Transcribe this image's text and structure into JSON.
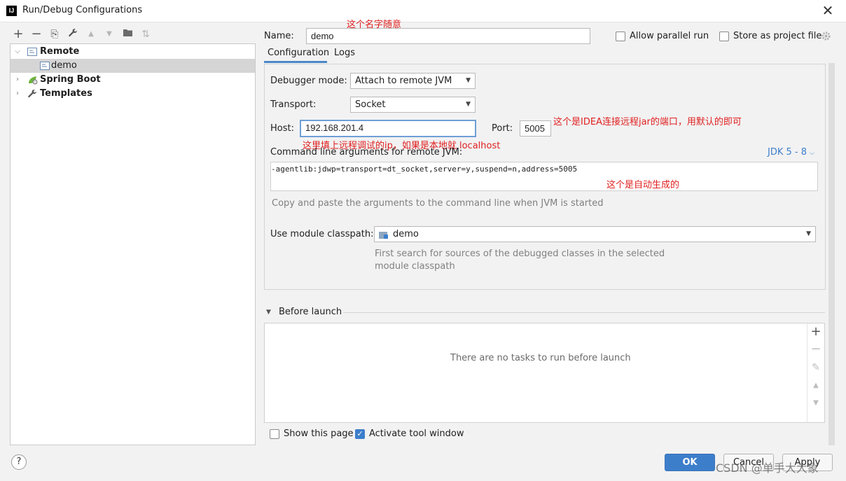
{
  "window": {
    "title": "Run/Debug Configurations",
    "app_icon_text": "IJ",
    "close_glyph": "✕"
  },
  "toolbar": {
    "icons": [
      {
        "name": "add-icon",
        "glyph": "+"
      },
      {
        "name": "remove-icon",
        "glyph": "−"
      },
      {
        "name": "copy-icon",
        "glyph": "⎘"
      },
      {
        "name": "wrench-icon",
        "glyph": "🔧"
      },
      {
        "name": "move-up-icon",
        "glyph": "▲"
      },
      {
        "name": "move-down-icon",
        "glyph": "▼"
      },
      {
        "name": "folder-icon",
        "glyph": "▆"
      },
      {
        "name": "sort-icon",
        "glyph": "⇅"
      }
    ]
  },
  "tree": {
    "remote": "Remote",
    "demo": "demo",
    "spring_boot": "Spring Boot",
    "templates": "Templates"
  },
  "form": {
    "name_label": "Name:",
    "name_value": "demo",
    "allow_parallel": "Allow parallel run",
    "store_project": "Store as project file",
    "tabs": [
      "Configuration",
      "Logs"
    ],
    "debugger_mode_label": "Debugger mode:",
    "debugger_mode_value": "Attach to remote JVM",
    "transport_label": "Transport:",
    "transport_value": "Socket",
    "host_label": "Host:",
    "host_value": "192.168.201.4",
    "port_label": "Port:",
    "port_value": "5005",
    "cmd_label": "Command line arguments for remote JVM:",
    "jdk_label": "JDK 5 - 8",
    "cmd_value": "-agentlib:jdwp=transport=dt_socket,server=y,suspend=n,address=5005",
    "cmd_hint": "Copy and paste the arguments to the command line when JVM is started",
    "module_label": "Use module classpath:",
    "module_value": "demo",
    "module_hint_1": "First search for sources of the debugged classes in the selected",
    "module_hint_2": "module classpath"
  },
  "before_launch": {
    "title": "Before launch",
    "empty": "There are no tasks to run before launch",
    "show_page": "Show this page",
    "activate_tool": "Activate tool window"
  },
  "buttons": {
    "help": "?",
    "ok": "OK",
    "cancel": "Cancel",
    "apply": "Apply"
  },
  "annotations": {
    "name_note": "这个名字随意",
    "port_note": "这个是IDEA连接远程jar的端口，用默认的即可",
    "host_note": "这里填上远程调试的ip，如果是本地就 localhost",
    "cmd_note": "这个是自动生成的"
  },
  "watermark": "CSDN @单手大大象",
  "colors": {
    "accent": "#3d7ecb",
    "annotation": "#e02020",
    "selected": "#d5d5d5"
  }
}
